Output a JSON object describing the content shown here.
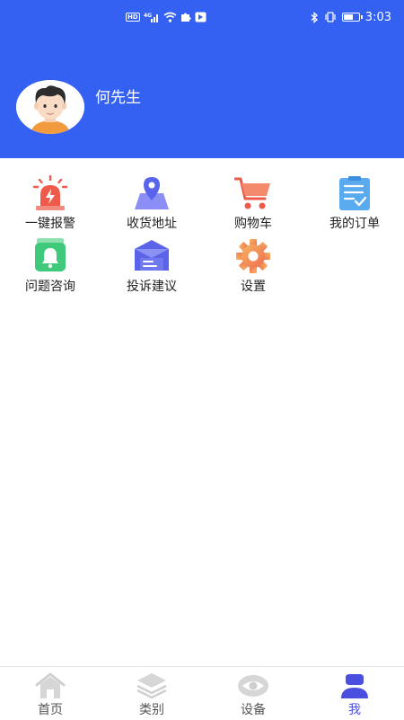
{
  "status_bar": {
    "time": "3:03",
    "hd": "HD",
    "network": "4G"
  },
  "profile": {
    "name": "何先生"
  },
  "menu": [
    {
      "label": "一键报警",
      "icon": "alarm-siren-icon"
    },
    {
      "label": "收货地址",
      "icon": "location-pin-icon"
    },
    {
      "label": "购物车",
      "icon": "shopping-cart-icon"
    },
    {
      "label": "我的订单",
      "icon": "order-list-icon"
    },
    {
      "label": "问题咨询",
      "icon": "bell-inquiry-icon"
    },
    {
      "label": "投诉建议",
      "icon": "mail-envelope-icon"
    },
    {
      "label": "设置",
      "icon": "gear-icon"
    }
  ],
  "tabbar": {
    "tabs": [
      {
        "label": "首页",
        "icon": "home-icon"
      },
      {
        "label": "类别",
        "icon": "layers-icon"
      },
      {
        "label": "设备",
        "icon": "eye-device-icon"
      },
      {
        "label": "我",
        "icon": "user-icon"
      }
    ],
    "active_index": 3
  },
  "colors": {
    "primary": "#3461f2",
    "tab_active": "#4b4fe0",
    "tab_inactive": "#cfcfcf"
  }
}
